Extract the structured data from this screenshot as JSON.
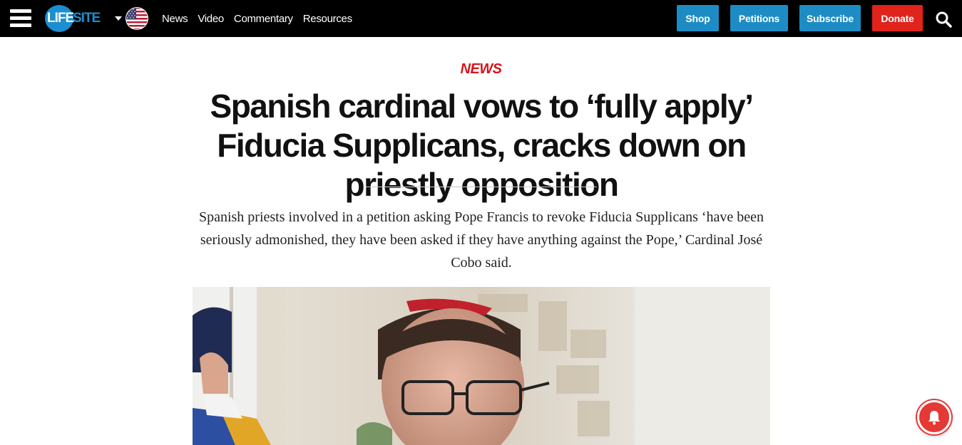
{
  "header": {
    "logo_left": "LIFE",
    "logo_right": "SITE",
    "nav": [
      "News",
      "Video",
      "Commentary",
      "Resources"
    ],
    "buttons": {
      "shop": "Shop",
      "petitions": "Petitions",
      "subscribe": "Subscribe",
      "donate": "Donate"
    },
    "icons": [
      "hamburger-menu-icon",
      "us-flag-icon",
      "search-icon"
    ]
  },
  "article": {
    "kicker": "NEWS",
    "headline": "Spanish cardinal vows to ‘fully apply’ Fiducia Supplicans, cracks down on priestly opposition",
    "dek": "Spanish priests involved in a petition asking Pope Francis to revoke Fiducia Supplicans ‘have been seriously admonished, they have been asked if they have anything against the Pope,’ Cardinal José Cobo said."
  },
  "colors": {
    "topbar": "#000000",
    "brand_blue": "#1b8fd1",
    "button_blue": "#1e8cc4",
    "donate_red": "#e0231b",
    "kicker_red": "#d4161b"
  },
  "widgets": {
    "notification": "bell-icon"
  }
}
